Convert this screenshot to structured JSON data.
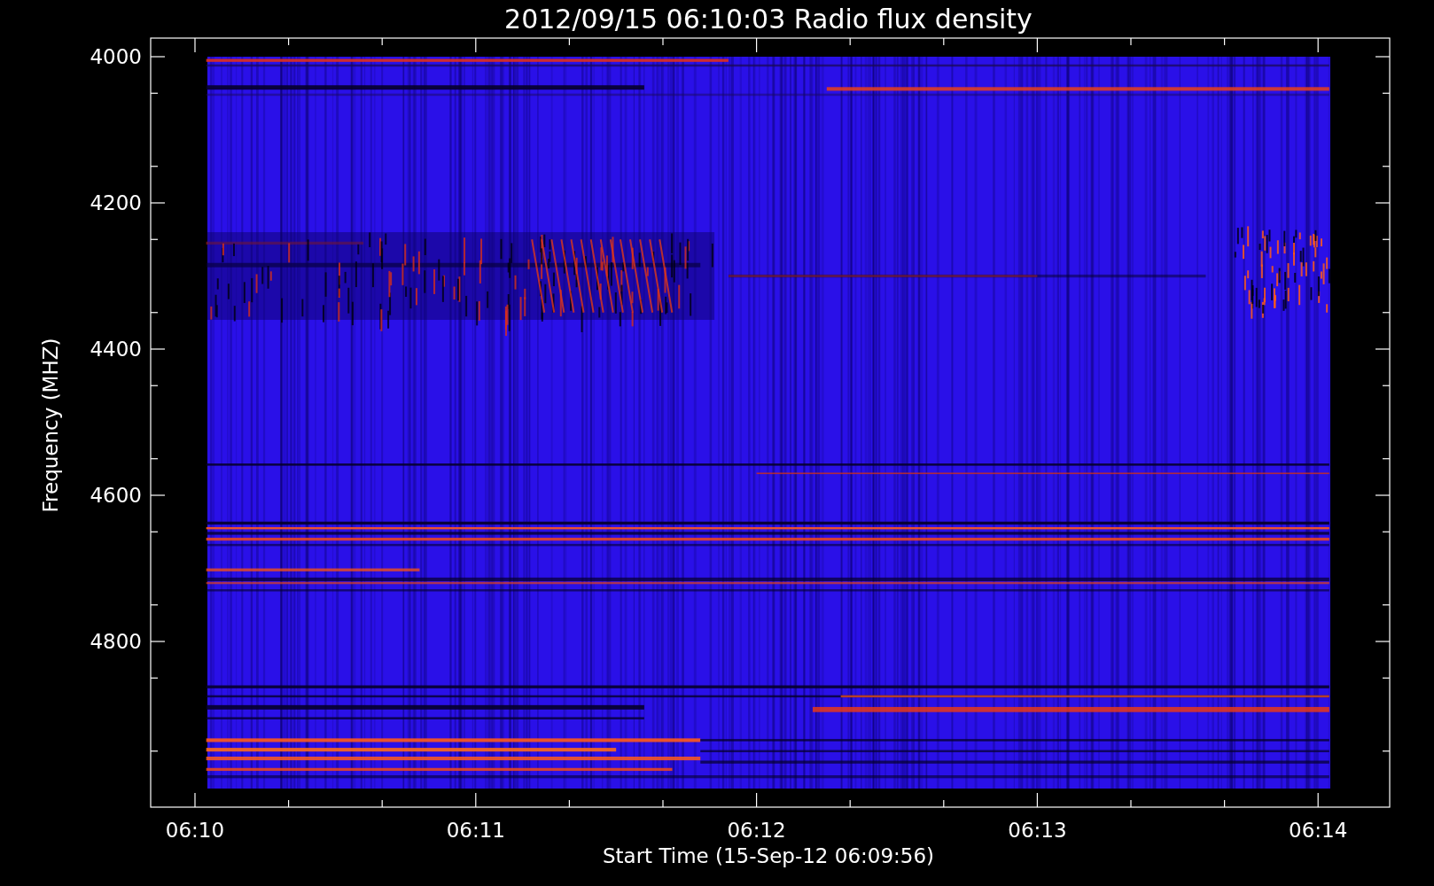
{
  "title": "2012/09/15 06:10:03 Radio flux density",
  "xlabel": "Start Time (15-Sep-12 06:09:56)",
  "ylabel": "Frequency (MHZ)",
  "xticks": [
    "06:10",
    "06:11",
    "06:12",
    "06:13",
    "06:14"
  ],
  "yticks": [
    "4000",
    "4200",
    "4400",
    "4600",
    "4800"
  ]
}
